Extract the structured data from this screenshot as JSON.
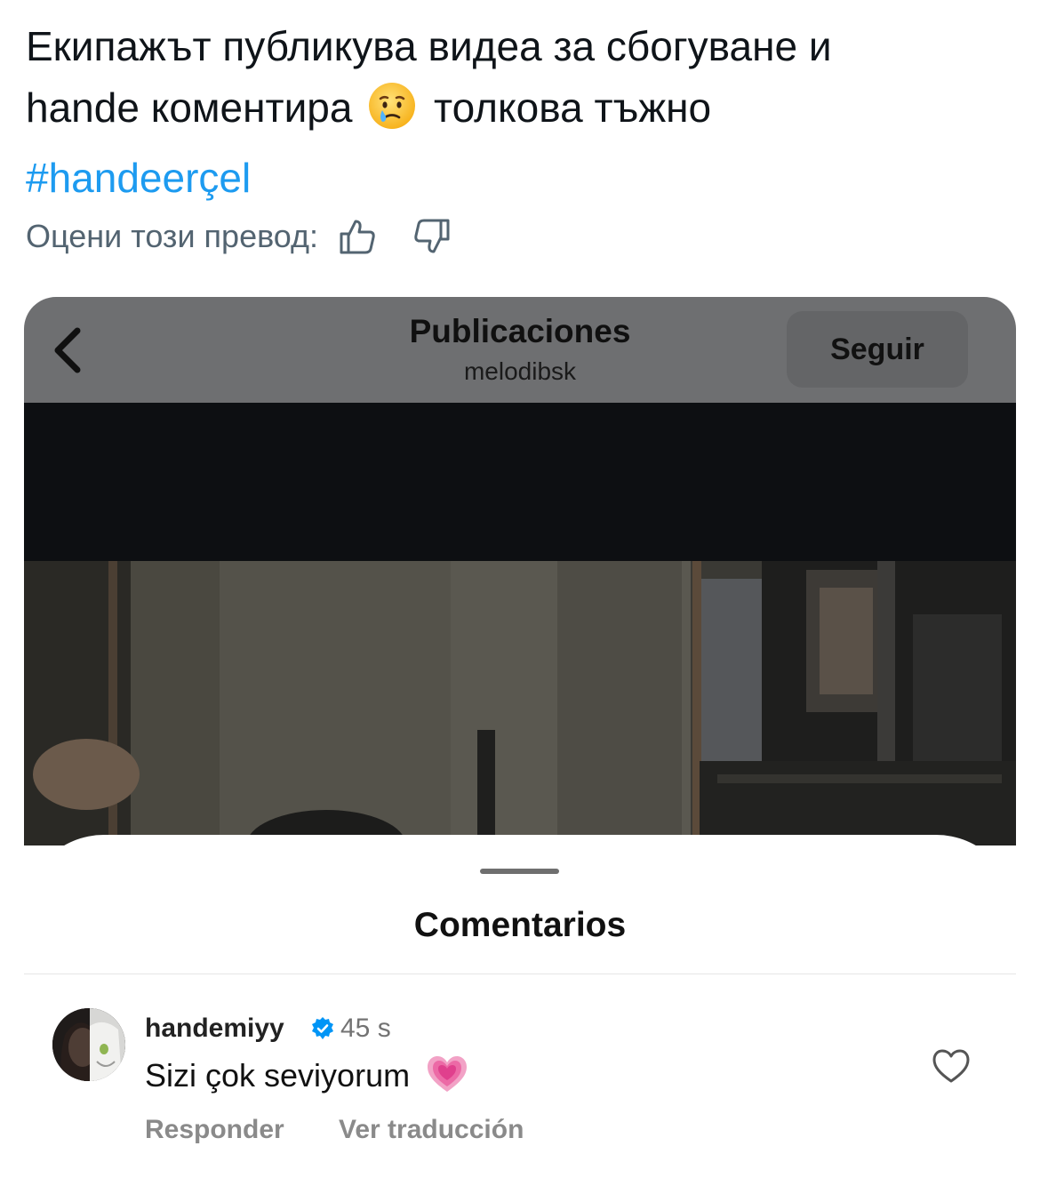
{
  "tweet": {
    "line1": "Екипажът публикува видеа за сбогуване и",
    "line2_before": "hande коментира",
    "line2_after": "толкова тъжно",
    "emoji": "sad-but-relieved-face-emoji",
    "hashtag": "#handeerçel"
  },
  "rate_translation": {
    "label": "Оцени този превод:",
    "icons": [
      "thumbs-up-icon",
      "thumbs-down-icon"
    ]
  },
  "screenshot": {
    "header": {
      "back_icon": "chevron-left-icon",
      "title": "Publicaciones",
      "username": "melodibsk",
      "follow_label": "Seguir"
    },
    "comments_sheet": {
      "title": "Comentarios",
      "comment": {
        "username": "handemiyy",
        "verified_icon": "verified-badge-icon",
        "time": "45 s",
        "text": "Sizi çok seviyorum",
        "emoji": "growing-heart-emoji",
        "like_icon": "heart-outline-icon",
        "reply_label": "Responder",
        "translate_label": "Ver traducción"
      }
    }
  },
  "colors": {
    "hashtag": "#1d9bf0",
    "muted_text": "#536471",
    "dim_overlay_header": "#6e6f71",
    "verified_blue": "#0095f6"
  }
}
